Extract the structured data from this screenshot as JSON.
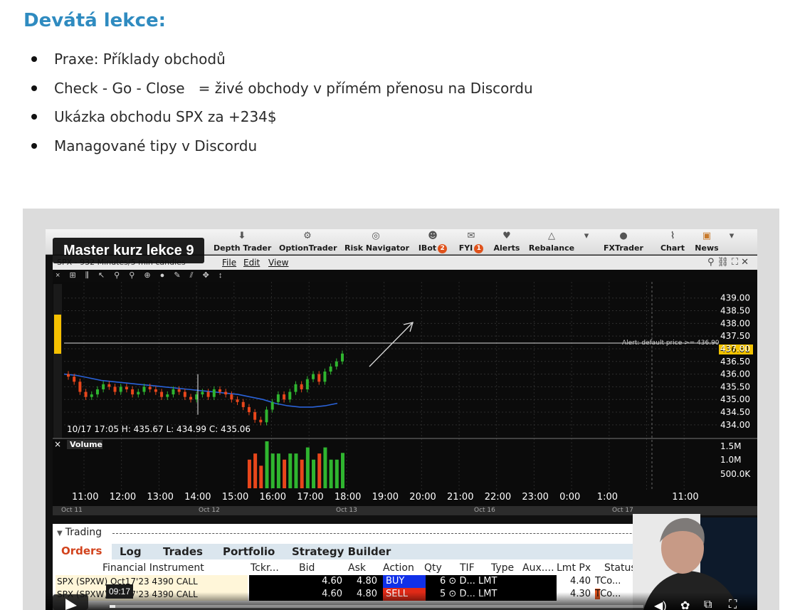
{
  "article": {
    "title": "Devátá lekce:",
    "bullets": [
      "Praxe: Příklady obchodů",
      "Check - Go - Close   = živé obchody v přímém přenosu na Discordu",
      "Ukázka obchodu SPX za +234$",
      "Managované tipy v Discordu"
    ]
  },
  "video": {
    "title": "Master kurz lekce 9",
    "time_tooltip": "09:17",
    "progress_fraction": 0.01,
    "icons": {
      "play": "play-icon",
      "volume": "volume-icon",
      "settings": "gear-icon",
      "pip": "picture-in-picture-icon",
      "fullscreen": "fullscreen-icon"
    }
  },
  "tws": {
    "toolbar": [
      {
        "label": "Depth Trader",
        "icon": "arrow-down-icon"
      },
      {
        "label": "OptionTrader",
        "icon": "option-icon"
      },
      {
        "label": "Risk Navigator",
        "icon": "compass-icon"
      },
      {
        "label": "IBot",
        "badge": "2",
        "icon": "bot-icon"
      },
      {
        "label": "FYI",
        "badge": "1",
        "icon": "megaphone-icon"
      },
      {
        "label": "Alerts",
        "icon": "bell-icon"
      },
      {
        "label": "Rebalance",
        "icon": "rebalance-icon"
      },
      {
        "label": "FXTrader",
        "icon": "fx-icon"
      },
      {
        "label": "Chart",
        "icon": "chart-icon"
      },
      {
        "label": "News",
        "icon": "rss-icon"
      }
    ],
    "chart_menu": {
      "symbol": "SPX - 932 Minutes/5 min candles",
      "items": [
        "File",
        "Edit",
        "View"
      ]
    },
    "trading": {
      "heading": "Trading",
      "tabs": [
        "Orders",
        "Log",
        "Trades",
        "Portfolio",
        "Strategy Builder"
      ],
      "columns": [
        "Financial Instrument",
        "Tckr...",
        "Bid",
        "Ask",
        "Action",
        "Qty",
        "TIF",
        "Type",
        "Aux....",
        "Lmt Px",
        "Status"
      ],
      "rows": [
        {
          "instrument": "SPX (SPXW) Oct17'23 4390 CALL",
          "bid": "4.60",
          "ask": "4.80",
          "action": "BUY",
          "qty": "6",
          "tif": "D...",
          "type": "LMT",
          "lmt": "4.40",
          "status": "Co..."
        },
        {
          "instrument": "SPX (SPXW) Oct17'23 4390 CALL",
          "bid": "4.60",
          "ask": "4.80",
          "action": "SELL",
          "qty": "5",
          "tif": "D...",
          "type": "LMT",
          "lmt": "4.30",
          "status": "Co..."
        }
      ]
    },
    "date_scroll": [
      "Oct 11",
      "Oct 12",
      "Oct 13",
      "Oct 16",
      "Oct 17"
    ]
  },
  "chart_data": {
    "type": "candlestick",
    "info_label": "10/17 17:05  H: 435.67  L: 434.99  C: 435.06",
    "alert_label": "Alert: default price >= 436.90",
    "last_price_label": "436.81",
    "alert_price": 436.9,
    "last_price": 436.81,
    "y_ticks": [
      439.0,
      438.5,
      438.0,
      437.5,
      437.0,
      436.5,
      436.0,
      435.5,
      435.0,
      434.5,
      434.0
    ],
    "ylim": [
      433.8,
      439.3
    ],
    "x_ticks": [
      "11:00",
      "12:00",
      "13:00",
      "14:00",
      "15:00",
      "16:00",
      "17:00",
      "18:00",
      "19:00",
      "20:00",
      "21:00",
      "22:00",
      "23:00",
      "0:00",
      "1:00",
      "",
      "11:00"
    ],
    "volume_label": "Volume",
    "volume_ticks": [
      "1.5M",
      "1.0M",
      "500.0K"
    ],
    "candles_close": [
      435.9,
      435.7,
      435.3,
      435.1,
      435.2,
      435.4,
      435.6,
      435.5,
      435.3,
      435.5,
      435.4,
      435.2,
      435.3,
      435.5,
      435.4,
      435.3,
      435.1,
      435.2,
      435.4,
      435.3,
      435.1,
      435.0,
      435.2,
      435.3,
      435.1,
      435.4,
      435.3,
      435.2,
      435.0,
      434.9,
      434.7,
      434.5,
      434.2,
      434.1,
      434.6,
      434.9,
      435.2,
      435.0,
      435.3,
      435.6,
      435.4,
      435.8,
      436.0,
      435.7,
      436.1,
      436.3,
      436.5,
      436.81
    ],
    "ma_series": [
      436.0,
      435.95,
      435.85,
      435.75,
      435.7,
      435.65,
      435.6,
      435.55,
      435.5,
      435.45,
      435.4,
      435.35,
      435.3,
      435.25,
      435.2,
      435.1,
      435.0,
      434.85,
      434.75,
      434.7,
      434.7,
      434.75,
      434.85
    ]
  }
}
